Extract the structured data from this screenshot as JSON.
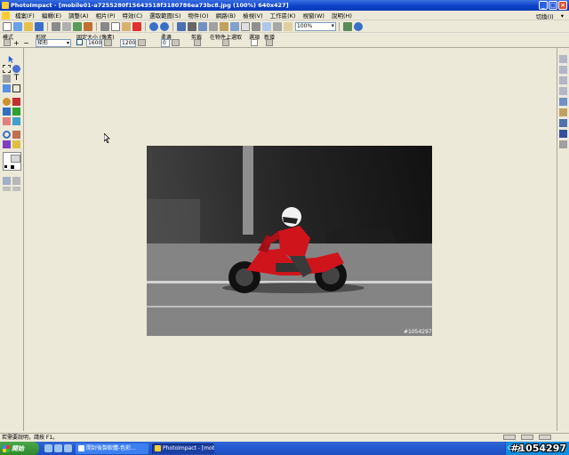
{
  "window": {
    "title": "PhotoImpact - [mobile01-a7255280f15643518f3180786ea73bc8.jpg (100%) 640x427]"
  },
  "menu": {
    "items": [
      "檔案(F)",
      "編輯(E)",
      "調整(A)",
      "相片(P)",
      "特效(C)",
      "選取範圍(S)",
      "物件(O)",
      "網路(B)",
      "檢視(V)",
      "工作區(K)",
      "視窗(W)",
      "說明(H)"
    ],
    "right_items": [
      "切換(I)",
      "▾"
    ]
  },
  "toolbar": {
    "zoom_value": "100%"
  },
  "properties": {
    "mode_label": "模式",
    "shape_label": "形狀",
    "shape_value": "矩形",
    "fixed_size_label": "固定大小 (像素)",
    "width_value": "1600",
    "height_value": "1200",
    "soft_edge_label": "柔邊",
    "soft_edge_value": "0",
    "select_label": "剪裁",
    "on_object_label": "在物件上選取",
    "options_label": "選項",
    "new_label": "新增"
  },
  "image": {
    "stamp_text": "#1054297"
  },
  "status": {
    "text": "若需要說明，請按 F1。"
  },
  "taskbar": {
    "start_label": "開始",
    "tasks": [
      "開封後製軟體-色彩...",
      "PhotoImpact - [mobile..."
    ],
    "tray_text": "CH",
    "watermark": "#1054297"
  },
  "colors": {
    "titlebar": "#0a3fc8",
    "chrome": "#ece9d8",
    "taskbar": "#245ad0",
    "bike_red": "#d0141c"
  }
}
